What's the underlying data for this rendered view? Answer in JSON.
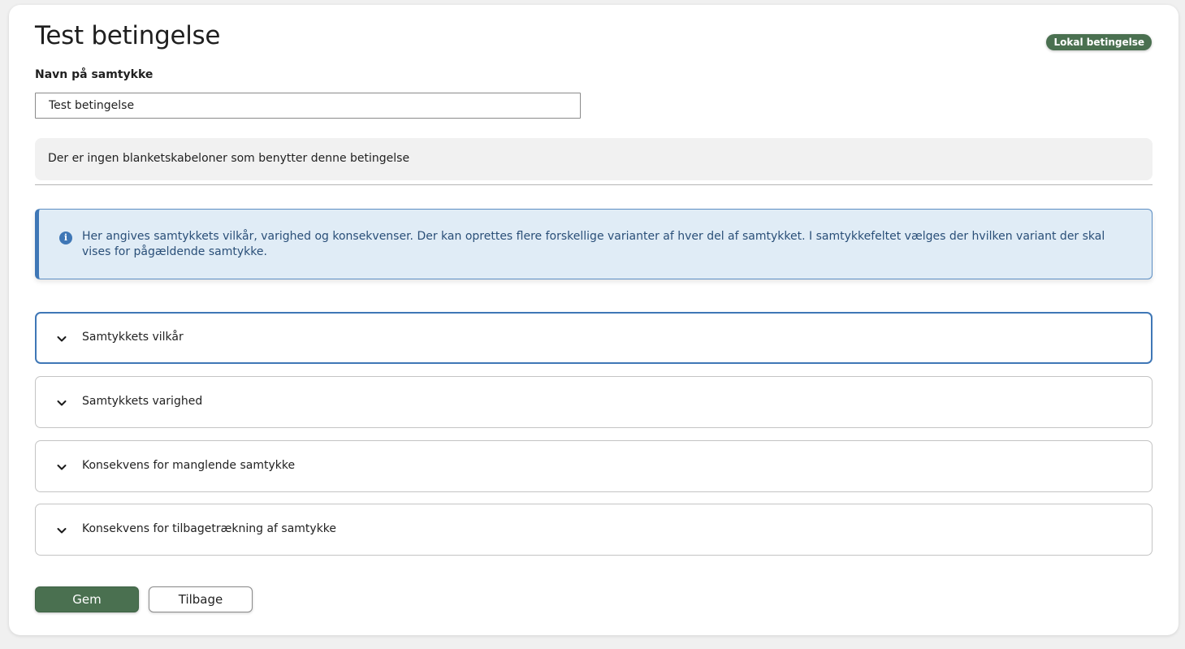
{
  "page": {
    "title": "Test betingelse",
    "badge": "Lokal betingelse"
  },
  "form": {
    "name_label": "Navn på samtykke",
    "name_value": "Test betingelse"
  },
  "notice": {
    "text": "Der er ingen blanketskabeloner som benytter denne betingelse"
  },
  "info": {
    "icon": "info-icon",
    "text": "Her angives samtykkets vilkår, varighed og konsekvenser. Der kan oprettes flere forskellige varianter af hver del af samtykket. I samtykkefeltet vælges der hvilken variant der skal vises for pågældende samtykke."
  },
  "accordions": [
    {
      "label": "Samtykkets vilkår",
      "icon": "chevron-down-icon",
      "focused": true
    },
    {
      "label": "Samtykkets varighed",
      "icon": "chevron-down-icon",
      "focused": false
    },
    {
      "label": "Konsekvens for manglende samtykke",
      "icon": "chevron-down-icon",
      "focused": false
    },
    {
      "label": "Konsekvens for tilbagetrækning af samtykke",
      "icon": "chevron-down-icon",
      "focused": false
    }
  ],
  "actions": {
    "save_label": "Gem",
    "back_label": "Tilbage"
  },
  "colors": {
    "primary_green": "#4a7050",
    "info_blue": "#3f77b6",
    "info_background": "#e0ecf6",
    "notice_background": "#f1f1f1"
  }
}
